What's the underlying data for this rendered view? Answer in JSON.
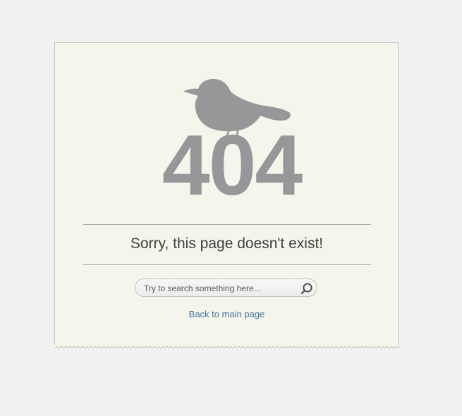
{
  "error": {
    "code": "404",
    "message": "Sorry, this page doesn't exist!"
  },
  "search": {
    "placeholder": "Try to search something here...",
    "value": ""
  },
  "navigation": {
    "back_link": "Back to main page"
  },
  "icons": {
    "illustration": "bird-icon",
    "search": "search-icon"
  },
  "colors": {
    "background": "#f1f1f1",
    "card_background": "#f5f5eb",
    "error_code": "#979698",
    "message_text": "#3f3f3f",
    "link": "#43719e"
  }
}
